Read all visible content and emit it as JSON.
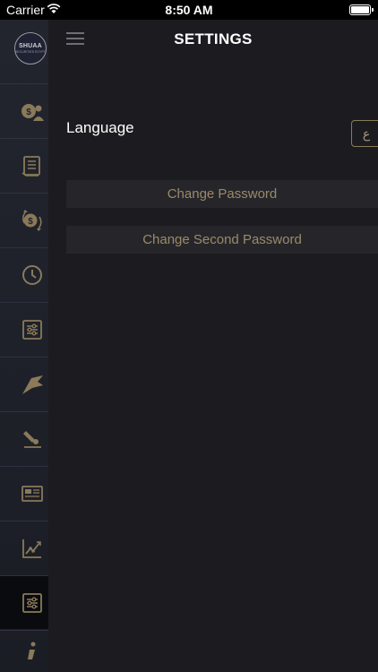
{
  "status_bar": {
    "carrier": "Carrier",
    "time": "8:50 AM"
  },
  "sidebar": {
    "logo_text": "SHUAA",
    "logo_sub": "SECURITIES EGYPT",
    "items": [
      {
        "icon": "money-user-icon"
      },
      {
        "icon": "document-icon"
      },
      {
        "icon": "money-transfer-icon"
      },
      {
        "icon": "clock-icon"
      },
      {
        "icon": "sliders-icon"
      },
      {
        "icon": "flag-icon"
      },
      {
        "icon": "pen-sign-icon"
      },
      {
        "icon": "news-icon"
      },
      {
        "icon": "chart-icon"
      },
      {
        "icon": "settings-icon",
        "active": true
      },
      {
        "icon": "info-icon"
      }
    ]
  },
  "header": {
    "title": "SETTINGS"
  },
  "settings": {
    "language_label": "Language",
    "language_toggle": "ع",
    "change_password": "Change Password",
    "change_second_password": "Change Second Password"
  },
  "colors": {
    "accent": "#9a8a6a",
    "background": "#1c1c20",
    "sidebar": "#22252e"
  }
}
